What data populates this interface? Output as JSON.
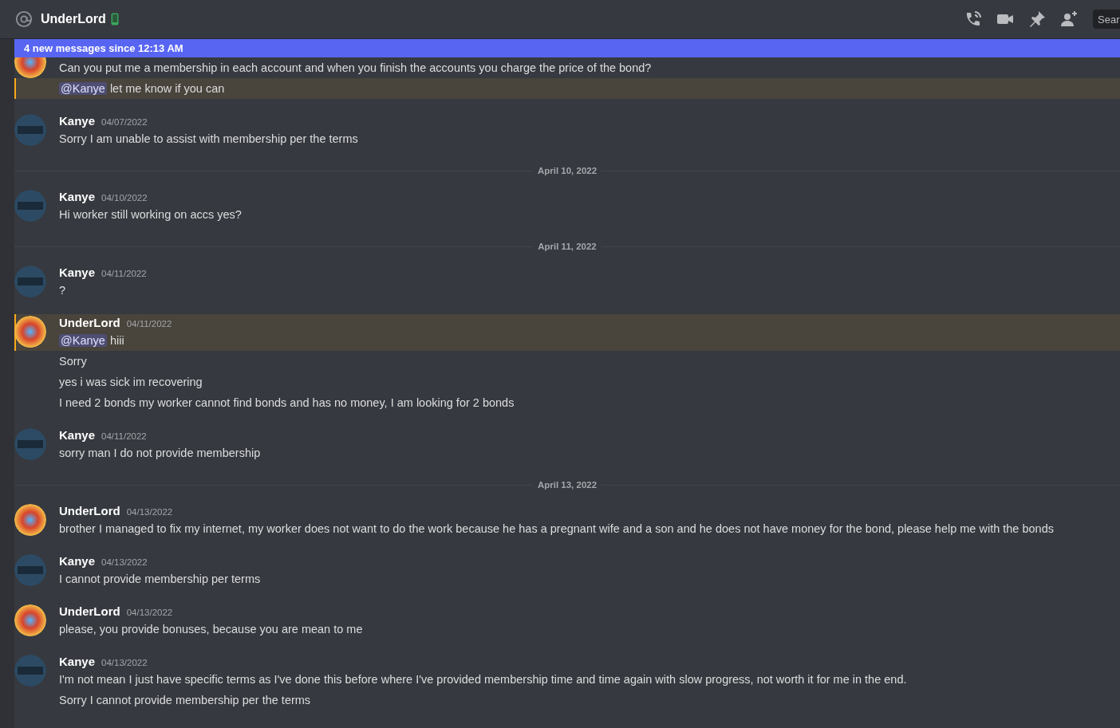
{
  "header": {
    "channel_name": "UnderLord",
    "search": {
      "placeholder": "Sear"
    }
  },
  "new_messages_banner": "4 new messages since 12:13 AM",
  "feed": [
    {
      "kind": "group",
      "avatar": {
        "kind": "hero"
      },
      "partial": true,
      "messages": [
        {
          "text": "Can you put me a membership in each account and when you finish the accounts you charge the price of the bond?",
          "highlighted": false
        },
        {
          "mention": "@Kanye",
          "text": "let me know if you can",
          "highlighted": true
        }
      ]
    },
    {
      "kind": "group",
      "avatar": {
        "kind": "badge"
      },
      "author": "Kanye",
      "timestamp": "04/07/2022",
      "messages": [
        {
          "text": "Sorry I am unable to assist with membership per the terms",
          "highlighted": false
        }
      ]
    },
    {
      "kind": "divider",
      "label": "April 10, 2022"
    },
    {
      "kind": "group",
      "avatar": {
        "kind": "badge"
      },
      "author": "Kanye",
      "timestamp": "04/10/2022",
      "messages": [
        {
          "text": "Hi worker still working on accs yes?",
          "highlighted": false
        }
      ]
    },
    {
      "kind": "divider",
      "label": "April 11, 2022"
    },
    {
      "kind": "group",
      "avatar": {
        "kind": "badge"
      },
      "author": "Kanye",
      "timestamp": "04/11/2022",
      "messages": [
        {
          "text": "?",
          "highlighted": false
        }
      ]
    },
    {
      "kind": "group",
      "avatar": {
        "kind": "hero"
      },
      "author": "UnderLord",
      "timestamp": "04/11/2022",
      "messages": [
        {
          "mention": "@Kanye",
          "text": "hiii",
          "highlighted": true
        },
        {
          "text": "Sorry",
          "highlighted": false
        },
        {
          "text": "yes i was sick im recovering",
          "highlighted": false
        },
        {
          "text": "I need 2 bonds my worker cannot find bonds and has no money, I am looking for 2 bonds",
          "highlighted": false
        }
      ]
    },
    {
      "kind": "group",
      "avatar": {
        "kind": "badge"
      },
      "author": "Kanye",
      "timestamp": "04/11/2022",
      "messages": [
        {
          "text": "sorry man I do not provide membership",
          "highlighted": false
        }
      ]
    },
    {
      "kind": "divider",
      "label": "April 13, 2022"
    },
    {
      "kind": "group",
      "avatar": {
        "kind": "hero"
      },
      "author": "UnderLord",
      "timestamp": "04/13/2022",
      "messages": [
        {
          "text": "brother I managed to fix my internet, my worker does not want to do the work because he has a pregnant wife and a son and he does not have money for the bond, please help me with the bonds",
          "highlighted": false
        }
      ]
    },
    {
      "kind": "group",
      "avatar": {
        "kind": "badge"
      },
      "author": "Kanye",
      "timestamp": "04/13/2022",
      "messages": [
        {
          "text": "I cannot provide membership per terms",
          "highlighted": false
        }
      ]
    },
    {
      "kind": "group",
      "avatar": {
        "kind": "hero"
      },
      "author": "UnderLord",
      "timestamp": "04/13/2022",
      "messages": [
        {
          "text": "please, you provide bonuses, because you are mean to me",
          "highlighted": false
        }
      ]
    },
    {
      "kind": "group",
      "avatar": {
        "kind": "badge"
      },
      "author": "Kanye",
      "timestamp": "04/13/2022",
      "messages": [
        {
          "text": "I'm not mean I just have specific terms as I've done this before where I've provided membership time and time again with slow progress, not worth it for me in the end.",
          "highlighted": false
        },
        {
          "text": "Sorry I cannot provide membership per the terms",
          "highlighted": false
        }
      ]
    }
  ]
}
